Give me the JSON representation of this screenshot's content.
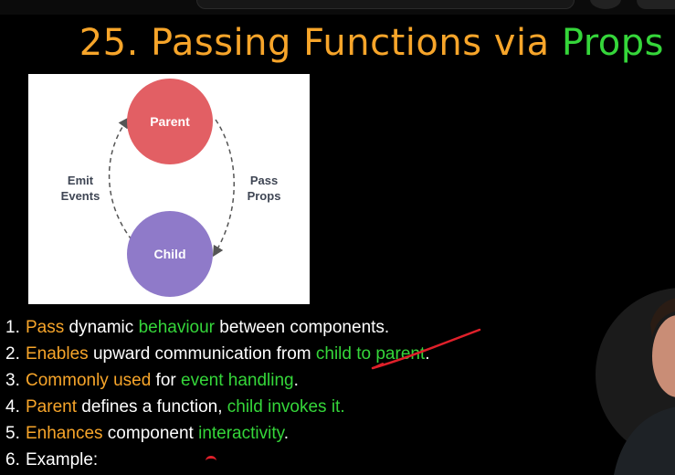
{
  "title": {
    "part1": "25. Passing Functions via ",
    "part2": "Props"
  },
  "diagram": {
    "parent_label": "Parent",
    "child_label": "Child",
    "left_line1": "Emit",
    "left_line2": "Events",
    "right_line1": "Pass",
    "right_line2": "Props",
    "parent_color": "#e25f64",
    "child_color": "#8f7ac9"
  },
  "points": [
    {
      "num": "1.",
      "a": "Pass",
      "b": " dynamic ",
      "c": "behaviour",
      "d": " between components."
    },
    {
      "num": "2.",
      "a": "Enables",
      "b": " upward communication from ",
      "c": "child to parent",
      "d": "."
    },
    {
      "num": "3.",
      "a": "Commonly used",
      "b": " for ",
      "c": "event handling",
      "d": "."
    },
    {
      "num": "4.",
      "a": "Parent",
      "b": " defines a function, ",
      "c": "child invokes it.",
      "d": ""
    },
    {
      "num": "5.",
      "a": "Enhances",
      "b": " component ",
      "c": "interactivity",
      "d": "."
    },
    {
      "num": "6.",
      "a": "Example:",
      "b": "",
      "c": "",
      "d": ""
    }
  ],
  "colors": {
    "accent_orange": "#f7a52a",
    "accent_green": "#35d63a",
    "annotation_red": "#e0202a"
  }
}
